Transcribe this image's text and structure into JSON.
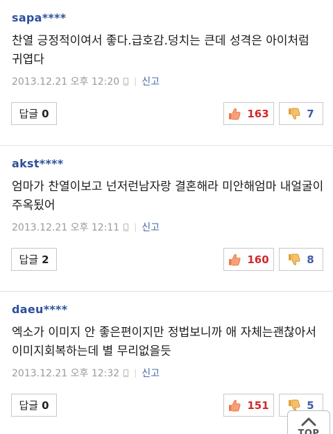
{
  "comments": [
    {
      "author": "sapa****",
      "text": "찬열 긍정적이여서 좋다.급호감.덩치는 큰데 성격은 아이처럼 귀엽다",
      "datetime": "2013.12.21 오후 12:20",
      "report_label": "신고",
      "reply_label": "답글",
      "reply_count": "0",
      "likes": "163",
      "dislikes": "7"
    },
    {
      "author": "akst****",
      "text": "엄마가 찬열이보고 넌저런남자랑 결혼해라 미안해엄마 내얼굴이 주옥됬어",
      "datetime": "2013.12.21 오후 12:11",
      "report_label": "신고",
      "reply_label": "답글",
      "reply_count": "2",
      "likes": "160",
      "dislikes": "8"
    },
    {
      "author": "daeu****",
      "text": "엑소가 이미지 안 좋은편이지만 정법보니까 애 자체는괜찮아서 이미지회복하는데 별 무리없을듯",
      "datetime": "2013.12.21 오후 12:32",
      "report_label": "신고",
      "reply_label": "답글",
      "reply_count": "0",
      "likes": "151",
      "dislikes": "5"
    }
  ],
  "top_button": {
    "label": "TOP"
  },
  "icons": {
    "like": "thumbs-up-icon",
    "dislike": "thumbs-down-icon",
    "device": "mobile-phone-icon",
    "top_arrow": "chevron-up-icon"
  },
  "colors": {
    "author": "#2d4f9c",
    "like_count": "#d0282c",
    "dislike_count": "#3d5da0",
    "report": "#4767a8",
    "meta": "#9a9a9a",
    "thumb_up": "#f07a4a",
    "thumb_down": "#e8a23a"
  }
}
